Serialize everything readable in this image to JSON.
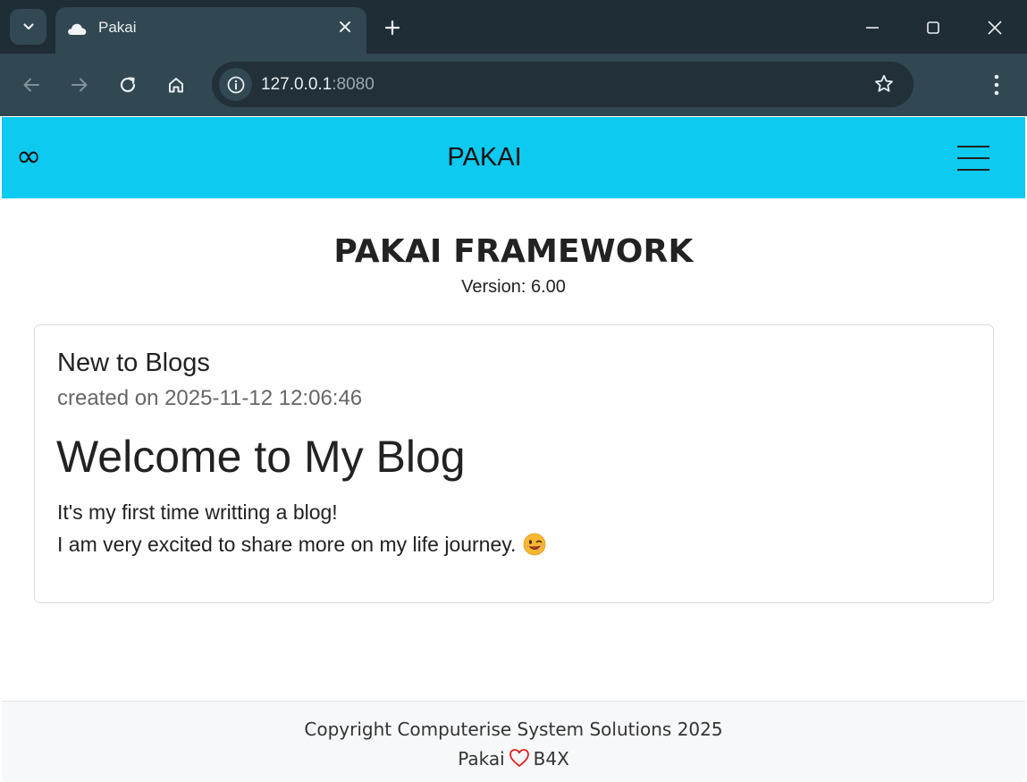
{
  "browser": {
    "tab_title": "Pakai",
    "url_host": "127.0.0.1",
    "url_port": ":8080",
    "icons": {
      "tab_menu": "chevron-down-icon",
      "favicon": "cloud-icon",
      "close": "close-icon",
      "new_tab": "plus-icon",
      "minimize": "minimize-icon",
      "maximize": "maximize-icon",
      "window_close": "close-icon",
      "back": "back-arrow-icon",
      "forward": "forward-arrow-icon",
      "reload": "reload-icon",
      "home": "home-icon",
      "site_info": "info-icon",
      "bookmark": "star-icon",
      "menu": "kebab-menu-icon"
    },
    "colors": {
      "tabbar": "#1f2d36",
      "toolbar": "#314751",
      "omnibox": "#213039"
    }
  },
  "app": {
    "logo_glyph": "∞",
    "brand": "PAKAI",
    "menu_icon": "hamburger-icon",
    "accent_color": "#0dcaf0"
  },
  "main": {
    "title": "PAKAI FRAMEWORK",
    "version": "Version: 6.00",
    "card": {
      "title": "New to Blogs",
      "created": "created on 2025-11-12 12:06:46",
      "heading": "Welcome to My Blog",
      "line1": "It's my first time writting a blog!",
      "line2": "I am very excited to share more on my life journey.",
      "emoji_icon": "winking-face-emoji-icon"
    }
  },
  "footer": {
    "copyright": "Copyright Computerise System Solutions 2025",
    "credit_left": "Pakai",
    "credit_right": "B4X",
    "heart_icon": "heart-icon",
    "heart_color": "#e02020"
  }
}
